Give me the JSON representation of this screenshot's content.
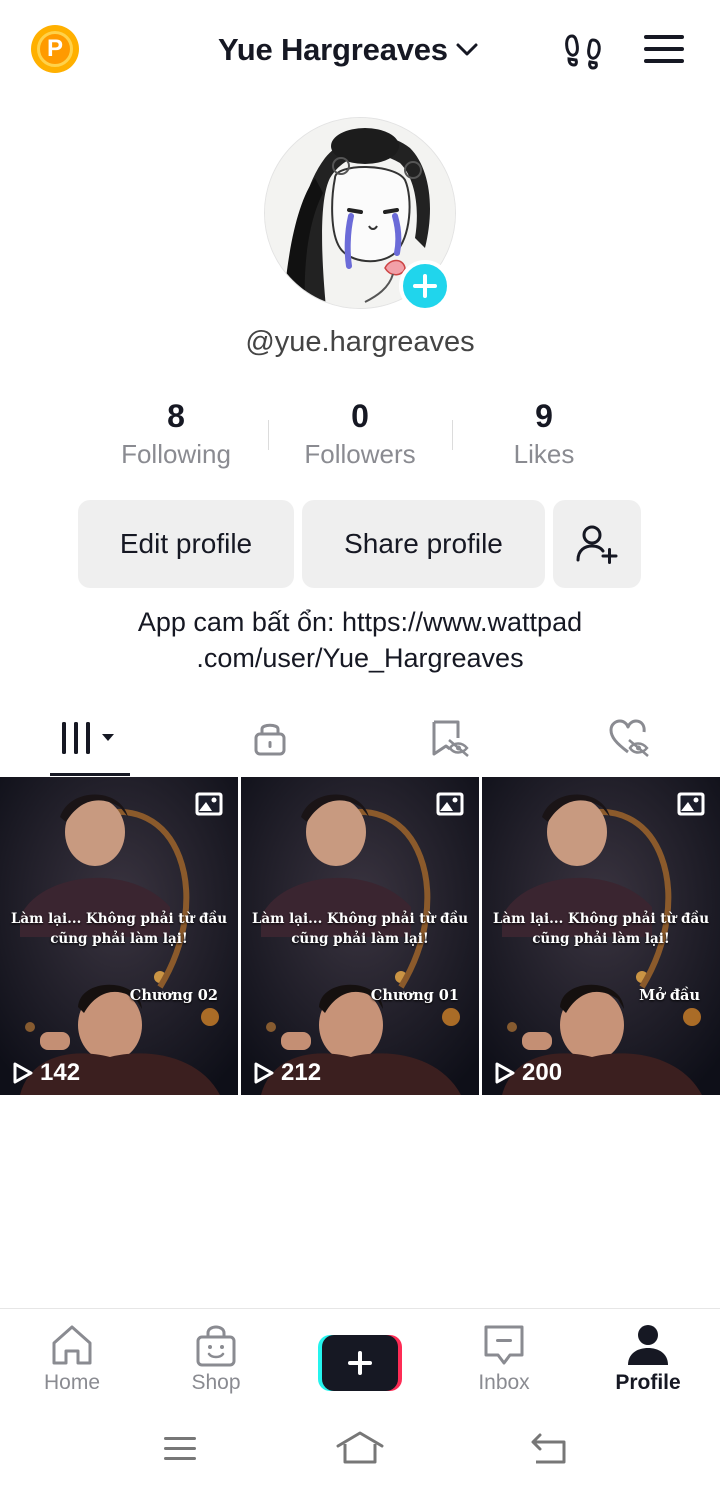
{
  "header": {
    "promo_letter": "P",
    "username_title": "Yue Hargreaves"
  },
  "profile": {
    "handle": "@yue.hargreaves",
    "stats": [
      {
        "value": "8",
        "label": "Following"
      },
      {
        "value": "0",
        "label": "Followers"
      },
      {
        "value": "9",
        "label": "Likes"
      }
    ],
    "edit_label": "Edit profile",
    "share_label": "Share profile",
    "bio": "App cam bất ổn: https://www.wattpad .com/user/Yue_Hargreaves"
  },
  "tabs": [
    {
      "icon": "grid-icon",
      "active": true
    },
    {
      "icon": "lock-icon",
      "active": false
    },
    {
      "icon": "saved-hidden-icon",
      "active": false
    },
    {
      "icon": "liked-hidden-icon",
      "active": false
    }
  ],
  "videos": [
    {
      "caption_line1": "Làm lại... Không phải từ đầu",
      "caption_line2": "cũng phải làm lại!",
      "chapter": "Chương 02",
      "views": "142"
    },
    {
      "caption_line1": "Làm lại... Không phải từ đầu",
      "caption_line2": "cũng phải làm lại!",
      "chapter": "Chương 01",
      "views": "212"
    },
    {
      "caption_line1": "Làm lại... Không phải từ đầu",
      "caption_line2": "cũng phải làm lại!",
      "chapter": "Mở đầu",
      "views": "200"
    }
  ],
  "bottom_nav": {
    "home": "Home",
    "shop": "Shop",
    "inbox": "Inbox",
    "profile": "Profile"
  },
  "colors": {
    "accent_cyan": "#20d5ec",
    "create_left": "#25f4ee",
    "create_right": "#fe2c55",
    "text_dark": "#161823",
    "text_muted": "#8a8b91"
  }
}
